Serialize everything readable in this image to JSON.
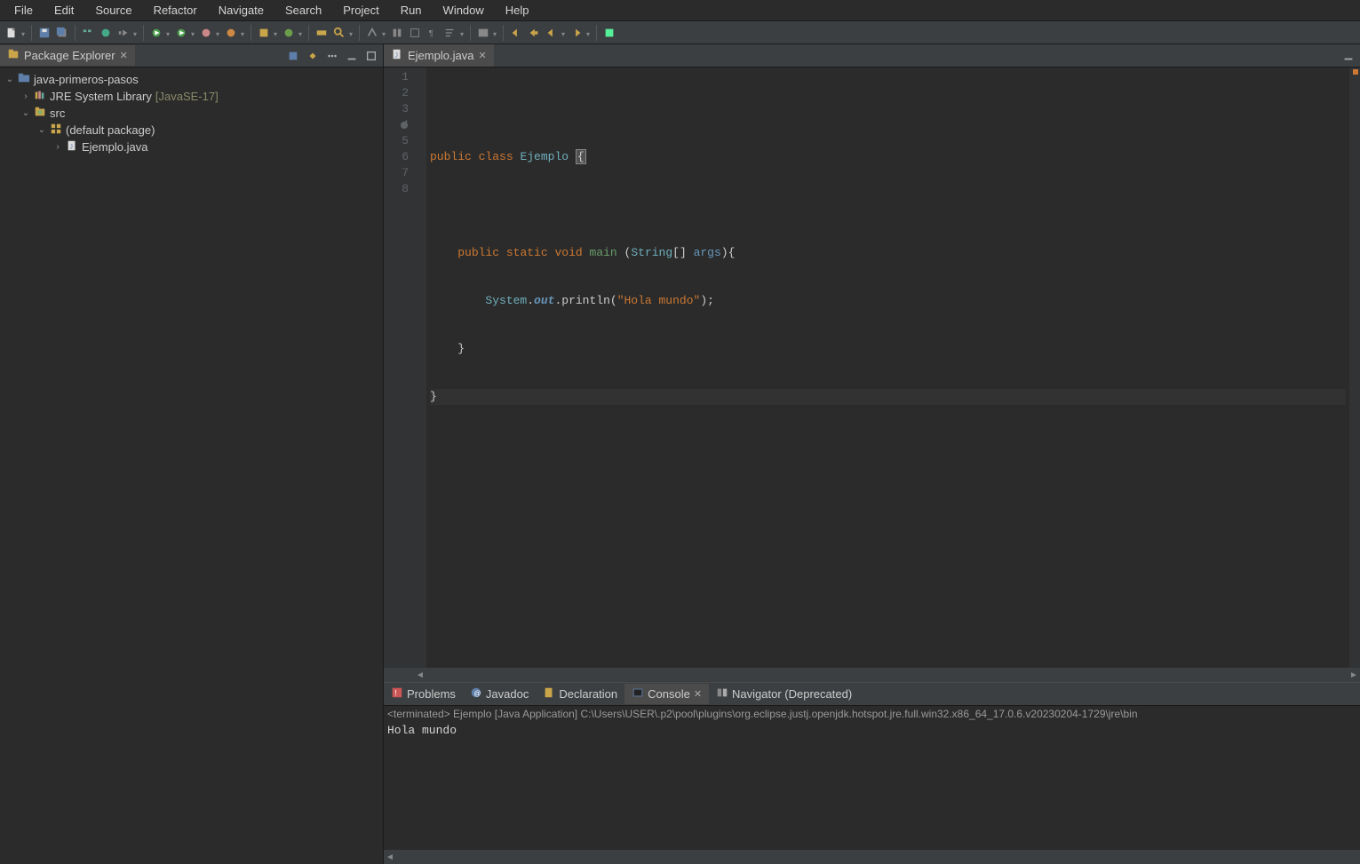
{
  "menubar": [
    "File",
    "Edit",
    "Source",
    "Refactor",
    "Navigate",
    "Search",
    "Project",
    "Run",
    "Window",
    "Help"
  ],
  "sidebar": {
    "title": "Package Explorer",
    "project": "java-primeros-pasos",
    "jre_label": "JRE System Library",
    "jre_version": "[JavaSE-17]",
    "src": "src",
    "pkg": "(default package)",
    "file": "Ejemplo.java"
  },
  "editor": {
    "tab": "Ejemplo.java",
    "lines": [
      "1",
      "2",
      "3",
      "4",
      "5",
      "6",
      "7",
      "8"
    ],
    "code": {
      "l2_mod1": "public",
      "l2_mod2": "class",
      "l2_name": "Ejemplo",
      "l2_brace": "{",
      "l4_mod1": "public",
      "l4_mod2": "static",
      "l4_mod3": "void",
      "l4_method": "main",
      "l4_p1": "(",
      "l4_type": "String",
      "l4_arr": "[] ",
      "l4_arg": "args",
      "l4_p2": "){",
      "l5_sys": "System",
      "l5_dot1": ".",
      "l5_out": "out",
      "l5_dot2": ".",
      "l5_println": "println",
      "l5_p1": "(",
      "l5_str": "\"Hola mundo\"",
      "l5_p2": ");",
      "l6": "}",
      "l7": "}"
    }
  },
  "bottom": {
    "tabs": {
      "problems": "Problems",
      "javadoc": "Javadoc",
      "declaration": "Declaration",
      "console": "Console",
      "navigator": "Navigator (Deprecated)"
    },
    "console_header": "<terminated> Ejemplo [Java Application] C:\\Users\\USER\\.p2\\pool\\plugins\\org.eclipse.justj.openjdk.hotspot.jre.full.win32.x86_64_17.0.6.v20230204-1729\\jre\\bin",
    "console_output": "Hola mundo"
  }
}
